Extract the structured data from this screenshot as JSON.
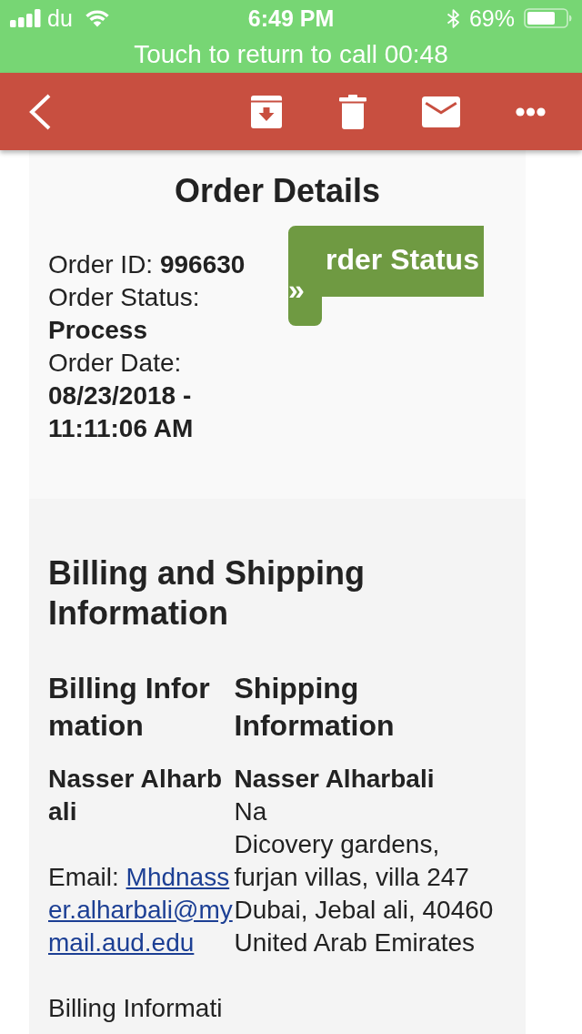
{
  "status_bar": {
    "carrier": "du",
    "time": "6:49 PM",
    "battery": "69%"
  },
  "call_banner": {
    "text": "Touch to return to call 00:48"
  },
  "order_details": {
    "title": "Order Details",
    "fields": [
      "Order ID: **996630**",
      "Order Status: **Process**",
      "Order Date: **08/23/2018 - 11:11:06 AM**"
    ],
    "status_button": {
      "label": "rder Status »"
    }
  },
  "billing_shipping": {
    "title": "Billing and Shipping Information",
    "billing": {
      "heading": "Billing Information",
      "name": "Nasser Alharbali",
      "email_label": "Email:",
      "email": "Mhdnasser.alharbali@mymail.aud.edu",
      "note": "Billing Informati"
    },
    "shipping": {
      "heading": "Shipping Information",
      "name": "Nasser Alharbali",
      "address_lines": [
        "Na",
        "Dicovery gardens,",
        "furjan villas, villa 247",
        "Dubai, Jebal ali, 40460",
        "United Arab Emirates"
      ]
    }
  }
}
